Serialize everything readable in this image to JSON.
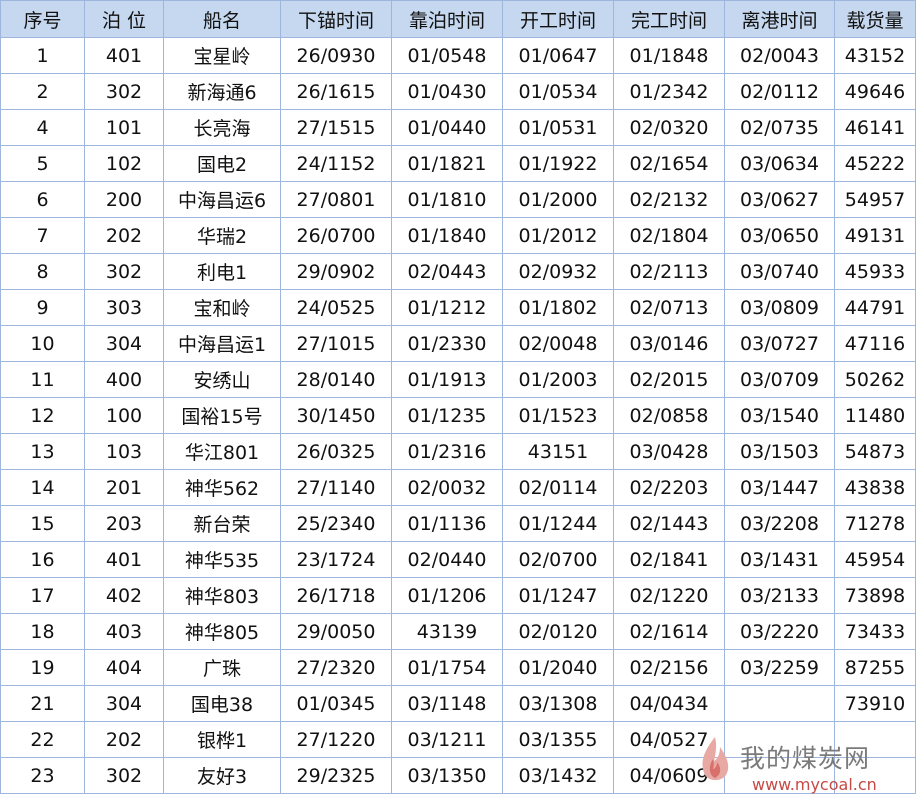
{
  "headers": [
    "序号",
    "泊 位",
    "船名",
    "下锚时间",
    "靠泊时间",
    "开工时间",
    "完工时间",
    "离港时间",
    "载货量"
  ],
  "rows": [
    [
      "1",
      "401",
      "宝星岭",
      "26/0930",
      "01/0548",
      "01/0647",
      "01/1848",
      "02/0043",
      "43152"
    ],
    [
      "2",
      "302",
      "新海通6",
      "26/1615",
      "01/0430",
      "01/0534",
      "01/2342",
      "02/0112",
      "49646"
    ],
    [
      "4",
      "101",
      "长亮海",
      "27/1515",
      "01/0440",
      "01/0531",
      "02/0320",
      "02/0735",
      "46141"
    ],
    [
      "5",
      "102",
      "国电2",
      "24/1152",
      "01/1821",
      "01/1922",
      "02/1654",
      "03/0634",
      "45222"
    ],
    [
      "6",
      "200",
      "中海昌运6",
      "27/0801",
      "01/1810",
      "01/2000",
      "02/2132",
      "03/0627",
      "54957"
    ],
    [
      "7",
      "202",
      "华瑞2",
      "26/0700",
      "01/1840",
      "01/2012",
      "02/1804",
      "03/0650",
      "49131"
    ],
    [
      "8",
      "302",
      "利电1",
      "29/0902",
      "02/0443",
      "02/0932",
      "02/2113",
      "03/0740",
      "45933"
    ],
    [
      "9",
      "303",
      "宝和岭",
      "24/0525",
      "01/1212",
      "01/1802",
      "02/0713",
      "03/0809",
      "44791"
    ],
    [
      "10",
      "304",
      "中海昌运1",
      "27/1015",
      "01/2330",
      "02/0048",
      "03/0146",
      "03/0727",
      "47116"
    ],
    [
      "11",
      "400",
      "安绣山",
      "28/0140",
      "01/1913",
      "01/2003",
      "02/2015",
      "03/0709",
      "50262"
    ],
    [
      "12",
      "100",
      "国裕15号",
      "30/1450",
      "01/1235",
      "01/1523",
      "02/0858",
      "03/1540",
      "11480"
    ],
    [
      "13",
      "103",
      "华江801",
      "26/0325",
      "01/2316",
      "43151",
      "03/0428",
      "03/1503",
      "54873"
    ],
    [
      "14",
      "201",
      "神华562",
      "27/1140",
      "02/0032",
      "02/0114",
      "02/2203",
      "03/1447",
      "43838"
    ],
    [
      "15",
      "203",
      "新台荣",
      "25/2340",
      "01/1136",
      "01/1244",
      "02/1443",
      "03/2208",
      "71278"
    ],
    [
      "16",
      "401",
      "神华535",
      "23/1724",
      "02/0440",
      "02/0700",
      "02/1841",
      "03/1431",
      "45954"
    ],
    [
      "17",
      "402",
      "神华803",
      "26/1718",
      "01/1206",
      "01/1247",
      "02/1220",
      "03/2133",
      "73898"
    ],
    [
      "18",
      "403",
      "神华805",
      "29/0050",
      "43139",
      "02/0120",
      "02/1614",
      "03/2220",
      "73433"
    ],
    [
      "19",
      "404",
      "广珠",
      "27/2320",
      "01/1754",
      "01/2040",
      "02/2156",
      "03/2259",
      "87255"
    ],
    [
      "21",
      "304",
      "国电38",
      "01/0345",
      "03/1148",
      "03/1308",
      "04/0434",
      "",
      "73910"
    ],
    [
      "22",
      "202",
      "银桦1",
      "27/1220",
      "03/1211",
      "03/1355",
      "04/0527",
      "",
      ""
    ],
    [
      "23",
      "302",
      "友好3",
      "29/2325",
      "03/1350",
      "03/1432",
      "04/0609",
      "",
      ""
    ]
  ],
  "watermark": {
    "title": "我的煤炭网",
    "url": "www.mycoal.cn"
  },
  "colors": {
    "header_bg": "#c6d8f0",
    "grid": "#9fb6dc",
    "watermark_text": "#7a7a7a",
    "watermark_url": "#c44a45"
  }
}
